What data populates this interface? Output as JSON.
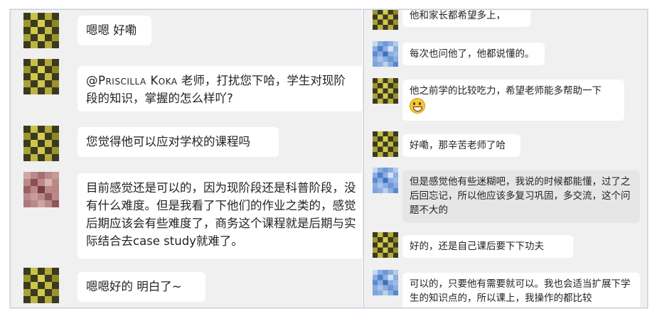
{
  "colors": {
    "pane_bg": "#f0f0f0",
    "bubble_white": "#ffffff",
    "bubble_grey": "#e6e6e6",
    "text": "#222222"
  },
  "left_chat": {
    "messages": [
      {
        "avatar": "avatar-yellow-pixel-icon",
        "text": "嗯嗯 好嘞"
      },
      {
        "avatar": "avatar-yellow-pixel-icon",
        "mention": "@Priscilla Koka",
        "text": " 老师，打扰您下哈，学生对现阶段的知识，掌握的怎么样吖?"
      },
      {
        "avatar": "avatar-yellow-pixel-icon",
        "text": "您觉得他可以应对学校的课程吗"
      },
      {
        "avatar": "avatar-pink-pixel-icon",
        "text": "目前感觉还是可以的，因为现阶段还是科普阶段，没有什么难度。但是我看了下他们的作业之类的，感觉后期应该会有些难度了，商务这个课程就是后期与实际结合去case study就难了。"
      },
      {
        "avatar": "avatar-yellow-pixel-icon",
        "text": "嗯嗯好的 明白了~"
      }
    ]
  },
  "right_chat": {
    "messages": [
      {
        "avatar": "avatar-yellow-pixel-icon",
        "text": "他和家长都希望多上，"
      },
      {
        "avatar": "avatar-blue-pixel-icon",
        "text": "每次也问他了，他都说懂的。"
      },
      {
        "avatar": "avatar-yellow-pixel-icon",
        "text": "他之前学的比较吃力，希望老师能多帮助一下",
        "emoji": "grinning-face-icon"
      },
      {
        "avatar": "avatar-yellow-pixel-icon",
        "text": "好嘞，那辛苦老师了哈"
      },
      {
        "avatar": "avatar-blue-pixel-icon",
        "text": "但是感觉他有些迷糊吧，我说的时候都能懂，过了之后回忘记，所以他应该多复习巩固，多交流，这个问题不大的"
      },
      {
        "avatar": "avatar-yellow-pixel-icon",
        "text": "好的，还是自己课后要下下功夫"
      },
      {
        "avatar": "avatar-blue-pixel-icon",
        "text": "可以的，只要他有需要就可以。我也会适当扩展下学生的知识点的，所以课上，我操作的都比较"
      }
    ]
  }
}
